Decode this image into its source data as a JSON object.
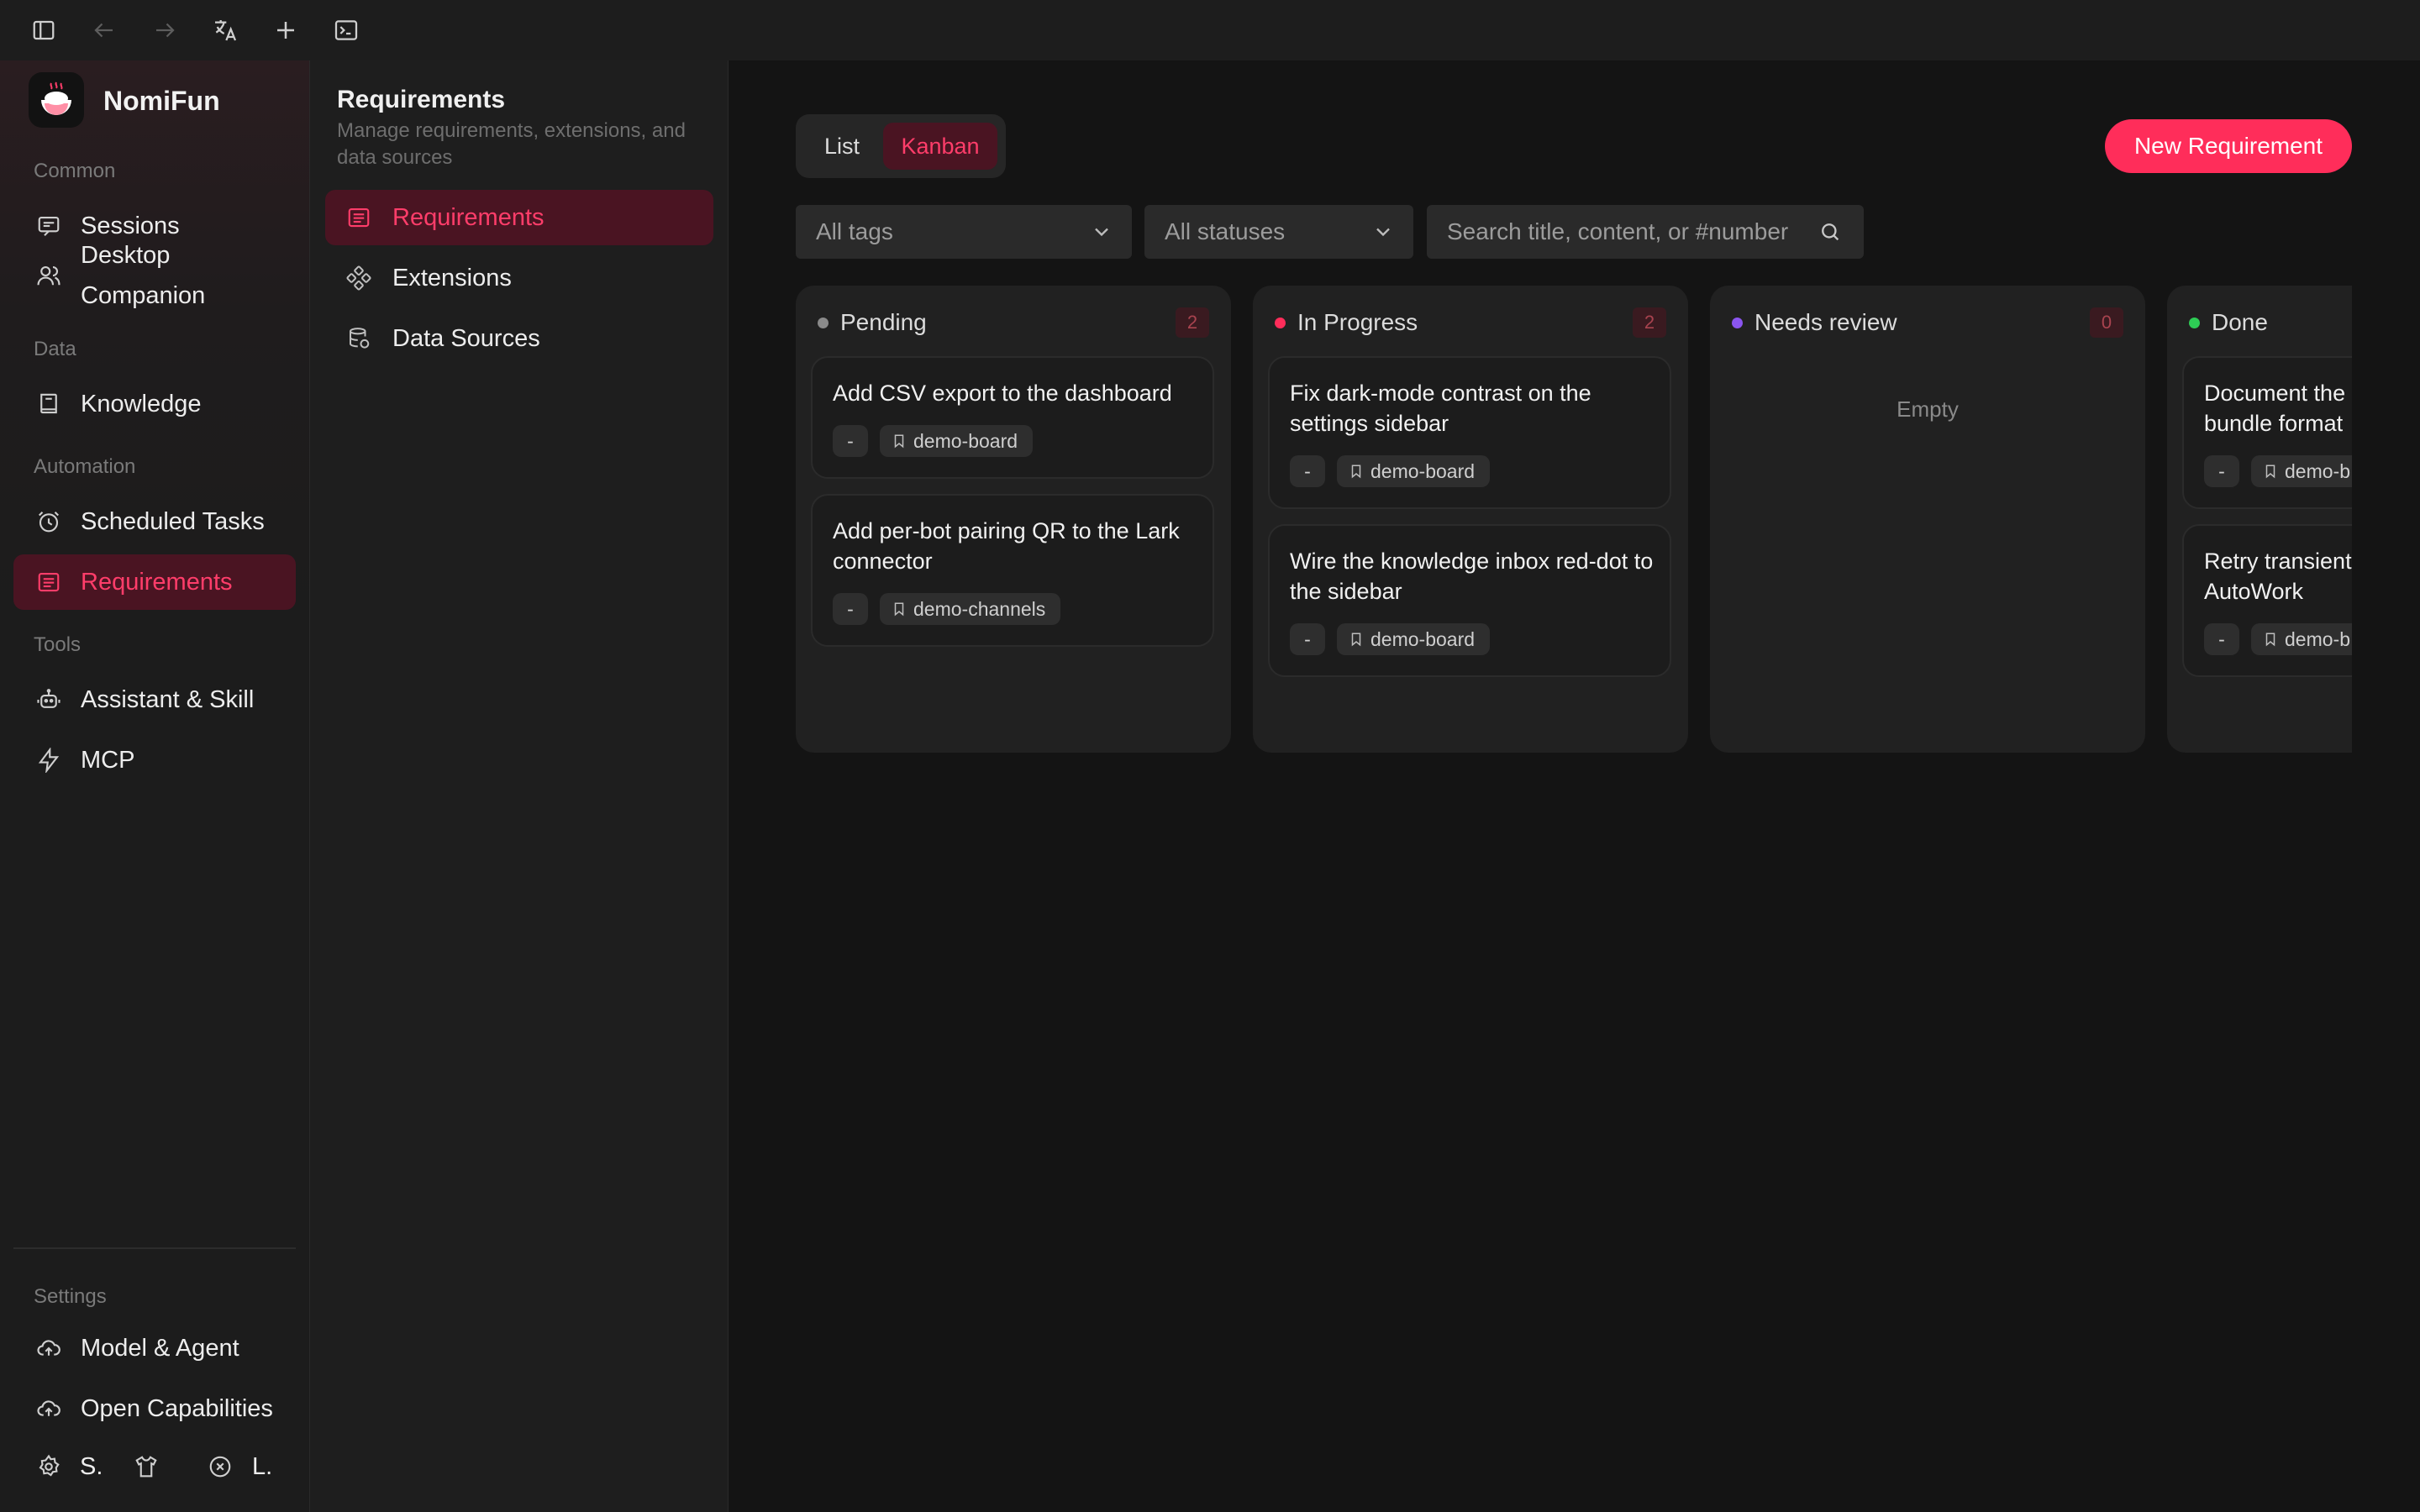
{
  "app": {
    "name": "NomiFun"
  },
  "colors": {
    "accent": "#ff2d5a",
    "accent_text": "#ff3d6a",
    "active_bg": "#4a1422",
    "pending": "#8a8a8a",
    "in_progress": "#ff2d5a",
    "needs_review": "#8b55f0",
    "done": "#2ecc55"
  },
  "topbar": {
    "icons": [
      "sidebar-toggle-icon",
      "back-arrow-icon",
      "forward-arrow-icon",
      "translate-icon",
      "plus-icon",
      "terminal-icon"
    ]
  },
  "nav": {
    "sections": {
      "common": "Common",
      "data": "Data",
      "automation": "Automation",
      "tools": "Tools",
      "settings": "Settings"
    },
    "items": {
      "sessions": "Sessions",
      "desktop_companion_1": "Desktop",
      "desktop_companion_2": "Companion",
      "knowledge": "Knowledge",
      "scheduled_tasks": "Scheduled Tasks",
      "requirements": "Requirements",
      "assistant_skill": "Assistant & Skill",
      "mcp": "MCP",
      "model_agent": "Model & Agent",
      "open_capabilities": "Open Capabilities"
    },
    "bottom": {
      "settings_short": "S.",
      "language_short": "L."
    }
  },
  "subnav": {
    "title": "Requirements",
    "description": "Manage requirements, extensions, and data sources",
    "items": {
      "requirements": "Requirements",
      "extensions": "Extensions",
      "data_sources": "Data Sources"
    }
  },
  "main": {
    "view_toggle": {
      "list": "List",
      "kanban": "Kanban",
      "selected": "Kanban"
    },
    "new_button": "New Requirement",
    "filters": {
      "tags": "All tags",
      "statuses": "All statuses",
      "search_placeholder": "Search title, content, or #number"
    }
  },
  "board": {
    "columns": [
      {
        "title": "Pending",
        "count": "2",
        "cards": [
          {
            "title": "Add CSV export to the dashboard",
            "priority": "-",
            "tag": "demo-board"
          },
          {
            "title": "Add per-bot pairing QR to the Lark connector",
            "priority": "-",
            "tag": "demo-channels"
          }
        ]
      },
      {
        "title": "In Progress",
        "count": "2",
        "cards": [
          {
            "title": "Fix dark-mode contrast on the settings sidebar",
            "priority": "-",
            "tag": "demo-board"
          },
          {
            "title": "Wire the knowledge inbox red-dot to the sidebar",
            "priority": "-",
            "tag": "demo-board"
          }
        ]
      },
      {
        "title": "Needs review",
        "count": "0",
        "empty_text": "Empty",
        "cards": []
      },
      {
        "title": "Done",
        "cards": [
          {
            "title": "Document the bundle format",
            "priority": "-",
            "tag": "demo-b"
          },
          {
            "title": "Retry transient AutoWork",
            "priority": "-",
            "tag": "demo-b"
          }
        ]
      }
    ]
  }
}
